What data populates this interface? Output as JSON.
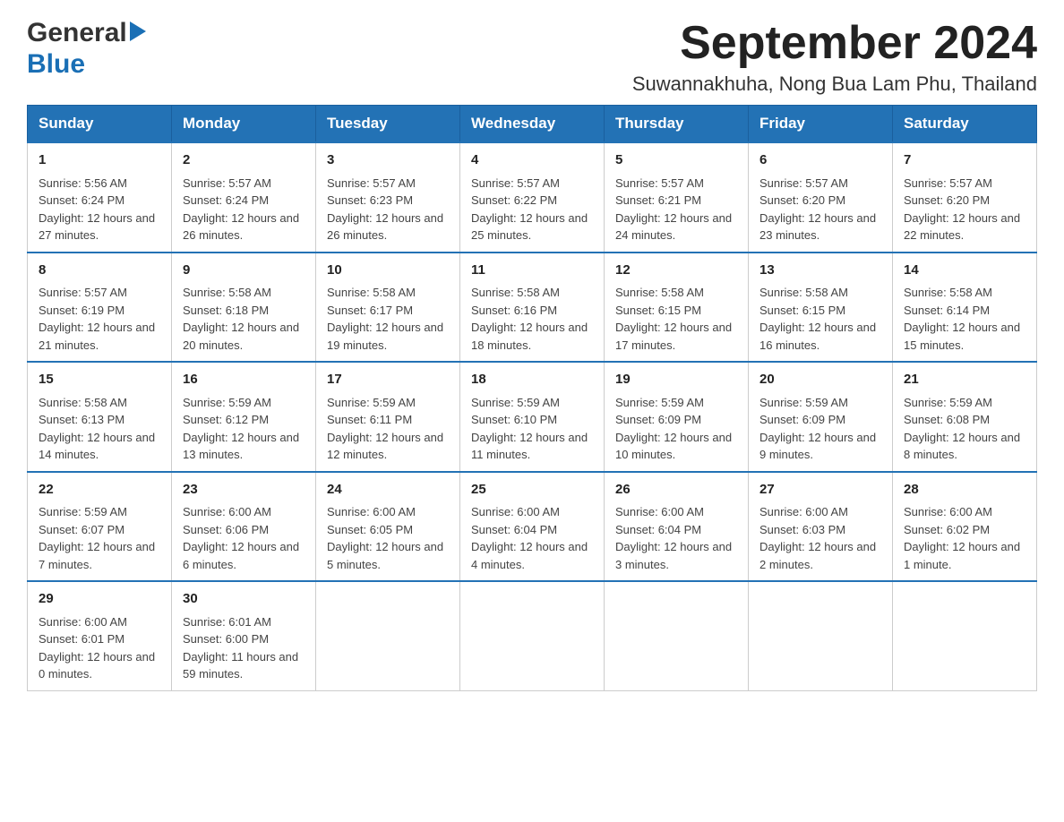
{
  "header": {
    "logo_general": "General",
    "logo_blue": "Blue",
    "month_title": "September 2024",
    "location": "Suwannakhuha, Nong Bua Lam Phu, Thailand"
  },
  "weekdays": [
    "Sunday",
    "Monday",
    "Tuesday",
    "Wednesday",
    "Thursday",
    "Friday",
    "Saturday"
  ],
  "weeks": [
    [
      {
        "day": "1",
        "sunrise": "5:56 AM",
        "sunset": "6:24 PM",
        "daylight": "12 hours and 27 minutes."
      },
      {
        "day": "2",
        "sunrise": "5:57 AM",
        "sunset": "6:24 PM",
        "daylight": "12 hours and 26 minutes."
      },
      {
        "day": "3",
        "sunrise": "5:57 AM",
        "sunset": "6:23 PM",
        "daylight": "12 hours and 26 minutes."
      },
      {
        "day": "4",
        "sunrise": "5:57 AM",
        "sunset": "6:22 PM",
        "daylight": "12 hours and 25 minutes."
      },
      {
        "day": "5",
        "sunrise": "5:57 AM",
        "sunset": "6:21 PM",
        "daylight": "12 hours and 24 minutes."
      },
      {
        "day": "6",
        "sunrise": "5:57 AM",
        "sunset": "6:20 PM",
        "daylight": "12 hours and 23 minutes."
      },
      {
        "day": "7",
        "sunrise": "5:57 AM",
        "sunset": "6:20 PM",
        "daylight": "12 hours and 22 minutes."
      }
    ],
    [
      {
        "day": "8",
        "sunrise": "5:57 AM",
        "sunset": "6:19 PM",
        "daylight": "12 hours and 21 minutes."
      },
      {
        "day": "9",
        "sunrise": "5:58 AM",
        "sunset": "6:18 PM",
        "daylight": "12 hours and 20 minutes."
      },
      {
        "day": "10",
        "sunrise": "5:58 AM",
        "sunset": "6:17 PM",
        "daylight": "12 hours and 19 minutes."
      },
      {
        "day": "11",
        "sunrise": "5:58 AM",
        "sunset": "6:16 PM",
        "daylight": "12 hours and 18 minutes."
      },
      {
        "day": "12",
        "sunrise": "5:58 AM",
        "sunset": "6:15 PM",
        "daylight": "12 hours and 17 minutes."
      },
      {
        "day": "13",
        "sunrise": "5:58 AM",
        "sunset": "6:15 PM",
        "daylight": "12 hours and 16 minutes."
      },
      {
        "day": "14",
        "sunrise": "5:58 AM",
        "sunset": "6:14 PM",
        "daylight": "12 hours and 15 minutes."
      }
    ],
    [
      {
        "day": "15",
        "sunrise": "5:58 AM",
        "sunset": "6:13 PM",
        "daylight": "12 hours and 14 minutes."
      },
      {
        "day": "16",
        "sunrise": "5:59 AM",
        "sunset": "6:12 PM",
        "daylight": "12 hours and 13 minutes."
      },
      {
        "day": "17",
        "sunrise": "5:59 AM",
        "sunset": "6:11 PM",
        "daylight": "12 hours and 12 minutes."
      },
      {
        "day": "18",
        "sunrise": "5:59 AM",
        "sunset": "6:10 PM",
        "daylight": "12 hours and 11 minutes."
      },
      {
        "day": "19",
        "sunrise": "5:59 AM",
        "sunset": "6:09 PM",
        "daylight": "12 hours and 10 minutes."
      },
      {
        "day": "20",
        "sunrise": "5:59 AM",
        "sunset": "6:09 PM",
        "daylight": "12 hours and 9 minutes."
      },
      {
        "day": "21",
        "sunrise": "5:59 AM",
        "sunset": "6:08 PM",
        "daylight": "12 hours and 8 minutes."
      }
    ],
    [
      {
        "day": "22",
        "sunrise": "5:59 AM",
        "sunset": "6:07 PM",
        "daylight": "12 hours and 7 minutes."
      },
      {
        "day": "23",
        "sunrise": "6:00 AM",
        "sunset": "6:06 PM",
        "daylight": "12 hours and 6 minutes."
      },
      {
        "day": "24",
        "sunrise": "6:00 AM",
        "sunset": "6:05 PM",
        "daylight": "12 hours and 5 minutes."
      },
      {
        "day": "25",
        "sunrise": "6:00 AM",
        "sunset": "6:04 PM",
        "daylight": "12 hours and 4 minutes."
      },
      {
        "day": "26",
        "sunrise": "6:00 AM",
        "sunset": "6:04 PM",
        "daylight": "12 hours and 3 minutes."
      },
      {
        "day": "27",
        "sunrise": "6:00 AM",
        "sunset": "6:03 PM",
        "daylight": "12 hours and 2 minutes."
      },
      {
        "day": "28",
        "sunrise": "6:00 AM",
        "sunset": "6:02 PM",
        "daylight": "12 hours and 1 minute."
      }
    ],
    [
      {
        "day": "29",
        "sunrise": "6:00 AM",
        "sunset": "6:01 PM",
        "daylight": "12 hours and 0 minutes."
      },
      {
        "day": "30",
        "sunrise": "6:01 AM",
        "sunset": "6:00 PM",
        "daylight": "11 hours and 59 minutes."
      },
      null,
      null,
      null,
      null,
      null
    ]
  ],
  "labels": {
    "sunrise_prefix": "Sunrise: ",
    "sunset_prefix": "Sunset: ",
    "daylight_prefix": "Daylight: "
  }
}
